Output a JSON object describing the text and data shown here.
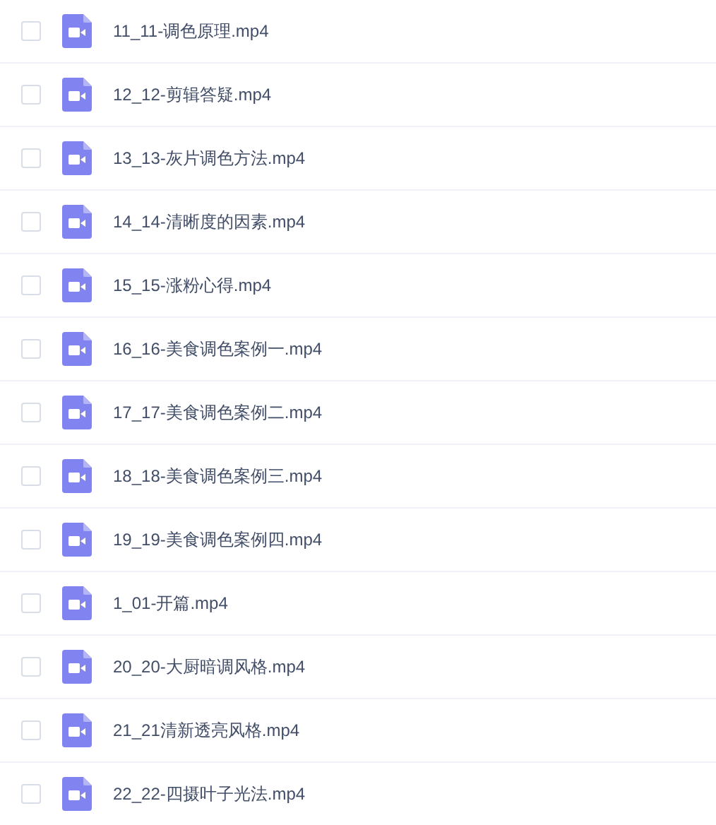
{
  "files": [
    {
      "name": "11_11-调色原理.mp4",
      "checked": false
    },
    {
      "name": "12_12-剪辑答疑.mp4",
      "checked": false
    },
    {
      "name": "13_13-灰片调色方法.mp4",
      "checked": false
    },
    {
      "name": "14_14-清晰度的因素.mp4",
      "checked": false
    },
    {
      "name": "15_15-涨粉心得.mp4",
      "checked": false
    },
    {
      "name": "16_16-美食调色案例一.mp4",
      "checked": false
    },
    {
      "name": "17_17-美食调色案例二.mp4",
      "checked": false
    },
    {
      "name": "18_18-美食调色案例三.mp4",
      "checked": false
    },
    {
      "name": "19_19-美食调色案例四.mp4",
      "checked": false
    },
    {
      "name": "1_01-开篇.mp4",
      "checked": false
    },
    {
      "name": "20_20-大厨暗调风格.mp4",
      "checked": false
    },
    {
      "name": "21_21清新透亮风格.mp4",
      "checked": false
    },
    {
      "name": "22_22-四摄叶子光法.mp4",
      "checked": false
    }
  ]
}
